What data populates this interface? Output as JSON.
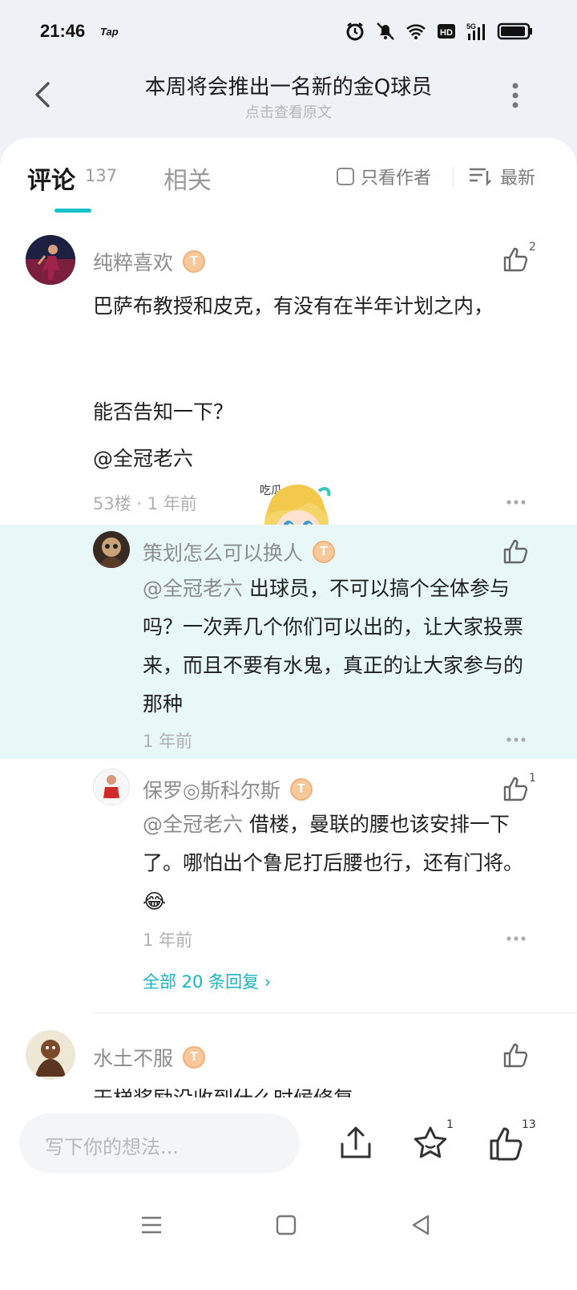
{
  "status": {
    "time": "21:46",
    "tap": "Tap"
  },
  "header": {
    "title": "本周将会推出一名新的金Q球员",
    "subtitle": "点击查看原文"
  },
  "tabs": {
    "comments_label": "评论",
    "comments_count": "137",
    "related_label": "相关",
    "only_author": "只看作者",
    "sort": "最新"
  },
  "comments": [
    {
      "username": "纯粹喜欢",
      "level": "T",
      "likes": "2",
      "text_line1": "巴萨布教授和皮克，有没有在半年计划之内，",
      "text_line2": "能否告知一下？",
      "text_line3": "@全冠老六",
      "meta": "53楼 · 1 年前"
    }
  ],
  "replies": [
    {
      "username": "策划怎么可以换人",
      "level": "T",
      "mention": "@全冠老六",
      "text": " 出球员，不可以搞个全体参与吗？一次弄几个你们可以出的，让大家投票来，而且不要有水鬼，真正的让大家参与的那种",
      "meta": "1 年前"
    },
    {
      "username": "保罗◎斯科尔斯",
      "level": "T",
      "likes": "1",
      "mention": "@全冠老六",
      "text": " 借楼，曼联的腰也该安排一下了。哪怕出个鲁尼打后腰也行，还有门将。😂",
      "meta": "1 年前"
    }
  ],
  "all_replies": "全部 20 条回复 ›",
  "next_comment": {
    "username": "水土不服",
    "level": "T",
    "text_partial": "天梯奖励没收到什么时候修复"
  },
  "bottom": {
    "placeholder": "写下你的想法...",
    "star_count": "1",
    "like_count": "13"
  },
  "colors": {
    "accent": "#15c2c8",
    "highlight": "#e8f8f8",
    "badge": "#f6c89a"
  }
}
